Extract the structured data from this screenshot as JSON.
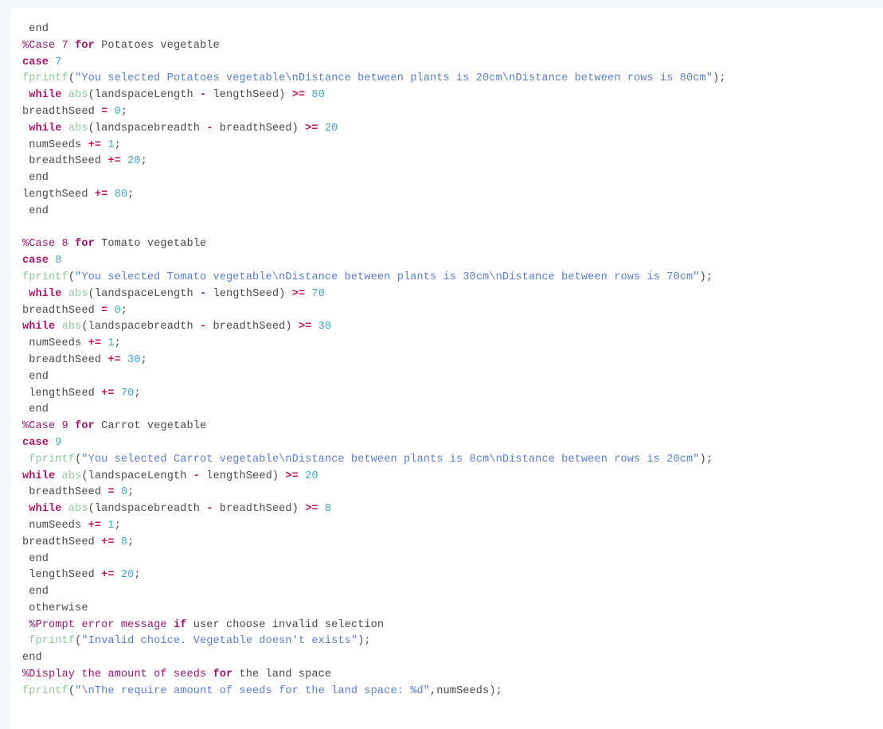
{
  "editor": {
    "language": "matlab",
    "background_color": "#ffffff",
    "page_background_color": "#f4f6f8",
    "default_text_color": "#4a4a4a",
    "token_colors": {
      "keyword": "#b0176a",
      "operator": "#c2185b",
      "number": "#3fa7d6",
      "comment": "#a0156e",
      "function": "#8fc99b",
      "string": "#5b7fd4"
    }
  },
  "code_lines": [
    {
      "id": "line-1",
      "text": " end",
      "tokens": [
        {
          "t": " end",
          "c": "plain"
        }
      ]
    },
    {
      "id": "line-2",
      "text": "%Case 7 for Potatoes vegetable",
      "tokens": [
        {
          "t": "%Case ",
          "c": "comment"
        },
        {
          "t": "7",
          "c": "comment-num"
        },
        {
          "t": " ",
          "c": "comment"
        },
        {
          "t": "for",
          "c": "comment-kw"
        },
        {
          "t": " Potatoes vegetable",
          "c": "plain"
        }
      ]
    },
    {
      "id": "line-3",
      "text": "case 7",
      "tokens": [
        {
          "t": "case",
          "c": "kw"
        },
        {
          "t": " ",
          "c": "plain"
        },
        {
          "t": "7",
          "c": "num"
        }
      ]
    },
    {
      "id": "line-4",
      "text": "fprintf(\"You selected Potatoes vegetable\\nDistance between plants is 20cm\\nDistance between rows is 80cm\");",
      "tokens": [
        {
          "t": "fprintf",
          "c": "fn"
        },
        {
          "t": "(",
          "c": "plain"
        },
        {
          "t": "\"You selected Potatoes vegetable\\nDistance between plants is 20cm\\nDistance between rows is 80cm\"",
          "c": "str"
        },
        {
          "t": ");",
          "c": "plain"
        }
      ]
    },
    {
      "id": "line-5",
      "text": " while abs(landspaceLength - lengthSeed) >= 80",
      "tokens": [
        {
          "t": " ",
          "c": "plain"
        },
        {
          "t": "while",
          "c": "kw"
        },
        {
          "t": " ",
          "c": "plain"
        },
        {
          "t": "abs",
          "c": "fn"
        },
        {
          "t": "(landspaceLength ",
          "c": "plain"
        },
        {
          "t": "-",
          "c": "op"
        },
        {
          "t": " lengthSeed) ",
          "c": "plain"
        },
        {
          "t": ">=",
          "c": "op"
        },
        {
          "t": " ",
          "c": "plain"
        },
        {
          "t": "80",
          "c": "num"
        }
      ]
    },
    {
      "id": "line-6",
      "text": "breadthSeed = 0;",
      "tokens": [
        {
          "t": "breadthSeed ",
          "c": "plain"
        },
        {
          "t": "=",
          "c": "op"
        },
        {
          "t": " ",
          "c": "plain"
        },
        {
          "t": "0",
          "c": "num"
        },
        {
          "t": ";",
          "c": "plain"
        }
      ]
    },
    {
      "id": "line-7",
      "text": " while abs(landspacebreadth - breadthSeed) >= 20",
      "tokens": [
        {
          "t": " ",
          "c": "plain"
        },
        {
          "t": "while",
          "c": "kw"
        },
        {
          "t": " ",
          "c": "plain"
        },
        {
          "t": "abs",
          "c": "fn"
        },
        {
          "t": "(landspacebreadth ",
          "c": "plain"
        },
        {
          "t": "-",
          "c": "op"
        },
        {
          "t": " breadthSeed) ",
          "c": "plain"
        },
        {
          "t": ">=",
          "c": "op"
        },
        {
          "t": " ",
          "c": "plain"
        },
        {
          "t": "20",
          "c": "num"
        }
      ]
    },
    {
      "id": "line-8",
      "text": " numSeeds += 1;",
      "tokens": [
        {
          "t": " numSeeds ",
          "c": "plain"
        },
        {
          "t": "+=",
          "c": "op"
        },
        {
          "t": " ",
          "c": "plain"
        },
        {
          "t": "1",
          "c": "num"
        },
        {
          "t": ";",
          "c": "plain"
        }
      ]
    },
    {
      "id": "line-9",
      "text": " breadthSeed += 20;",
      "tokens": [
        {
          "t": " breadthSeed ",
          "c": "plain"
        },
        {
          "t": "+=",
          "c": "op"
        },
        {
          "t": " ",
          "c": "plain"
        },
        {
          "t": "20",
          "c": "num"
        },
        {
          "t": ";",
          "c": "plain"
        }
      ]
    },
    {
      "id": "line-10",
      "text": " end",
      "tokens": [
        {
          "t": " end",
          "c": "plain"
        }
      ]
    },
    {
      "id": "line-11",
      "text": "lengthSeed += 80;",
      "tokens": [
        {
          "t": "lengthSeed ",
          "c": "plain"
        },
        {
          "t": "+=",
          "c": "op"
        },
        {
          "t": " ",
          "c": "plain"
        },
        {
          "t": "80",
          "c": "num"
        },
        {
          "t": ";",
          "c": "plain"
        }
      ]
    },
    {
      "id": "line-12",
      "text": " end",
      "tokens": [
        {
          "t": " end",
          "c": "plain"
        }
      ]
    },
    {
      "id": "line-13",
      "text": "",
      "tokens": []
    },
    {
      "id": "line-14",
      "text": "%Case 8 for Tomato vegetable",
      "tokens": [
        {
          "t": "%Case ",
          "c": "comment"
        },
        {
          "t": "8",
          "c": "comment-num"
        },
        {
          "t": " ",
          "c": "comment"
        },
        {
          "t": "for",
          "c": "comment-kw"
        },
        {
          "t": " Tomato vegetable",
          "c": "plain"
        }
      ]
    },
    {
      "id": "line-15",
      "text": "case 8",
      "tokens": [
        {
          "t": "case",
          "c": "kw"
        },
        {
          "t": " ",
          "c": "plain"
        },
        {
          "t": "8",
          "c": "num"
        }
      ]
    },
    {
      "id": "line-16",
      "text": "fprintf(\"You selected Tomato vegetable\\nDistance between plants is 30cm\\nDistance between rows is 70cm\");",
      "tokens": [
        {
          "t": "fprintf",
          "c": "fn"
        },
        {
          "t": "(",
          "c": "plain"
        },
        {
          "t": "\"You selected Tomato vegetable\\nDistance between plants is 30cm\\nDistance between rows is 70cm\"",
          "c": "str"
        },
        {
          "t": ");",
          "c": "plain"
        }
      ]
    },
    {
      "id": "line-17",
      "text": " while abs(landspaceLength - lengthSeed) >= 70",
      "tokens": [
        {
          "t": " ",
          "c": "plain"
        },
        {
          "t": "while",
          "c": "kw"
        },
        {
          "t": " ",
          "c": "plain"
        },
        {
          "t": "abs",
          "c": "fn"
        },
        {
          "t": "(landspaceLength ",
          "c": "plain"
        },
        {
          "t": "-",
          "c": "op"
        },
        {
          "t": " lengthSeed) ",
          "c": "plain"
        },
        {
          "t": ">=",
          "c": "op"
        },
        {
          "t": " ",
          "c": "plain"
        },
        {
          "t": "70",
          "c": "num"
        }
      ]
    },
    {
      "id": "line-18",
      "text": "breadthSeed = 0;",
      "tokens": [
        {
          "t": "breadthSeed ",
          "c": "plain"
        },
        {
          "t": "=",
          "c": "op"
        },
        {
          "t": " ",
          "c": "plain"
        },
        {
          "t": "0",
          "c": "num"
        },
        {
          "t": ";",
          "c": "plain"
        }
      ]
    },
    {
      "id": "line-19",
      "text": "while abs(landspacebreadth - breadthSeed) >= 30",
      "tokens": [
        {
          "t": "while",
          "c": "kw"
        },
        {
          "t": " ",
          "c": "plain"
        },
        {
          "t": "abs",
          "c": "fn"
        },
        {
          "t": "(landspacebreadth ",
          "c": "plain"
        },
        {
          "t": "-",
          "c": "op"
        },
        {
          "t": " breadthSeed) ",
          "c": "plain"
        },
        {
          "t": ">=",
          "c": "op"
        },
        {
          "t": " ",
          "c": "plain"
        },
        {
          "t": "30",
          "c": "num"
        }
      ]
    },
    {
      "id": "line-20",
      "text": " numSeeds += 1;",
      "tokens": [
        {
          "t": " numSeeds ",
          "c": "plain"
        },
        {
          "t": "+=",
          "c": "op"
        },
        {
          "t": " ",
          "c": "plain"
        },
        {
          "t": "1",
          "c": "num"
        },
        {
          "t": ";",
          "c": "plain"
        }
      ]
    },
    {
      "id": "line-21",
      "text": " breadthSeed += 30;",
      "tokens": [
        {
          "t": " breadthSeed ",
          "c": "plain"
        },
        {
          "t": "+=",
          "c": "op"
        },
        {
          "t": " ",
          "c": "plain"
        },
        {
          "t": "30",
          "c": "num"
        },
        {
          "t": ";",
          "c": "plain"
        }
      ]
    },
    {
      "id": "line-22",
      "text": " end",
      "tokens": [
        {
          "t": " end",
          "c": "plain"
        }
      ]
    },
    {
      "id": "line-23",
      "text": " lengthSeed += 70;",
      "tokens": [
        {
          "t": " lengthSeed ",
          "c": "plain"
        },
        {
          "t": "+=",
          "c": "op"
        },
        {
          "t": " ",
          "c": "plain"
        },
        {
          "t": "70",
          "c": "num"
        },
        {
          "t": ";",
          "c": "plain"
        }
      ]
    },
    {
      "id": "line-24",
      "text": " end",
      "tokens": [
        {
          "t": " end",
          "c": "plain"
        }
      ]
    },
    {
      "id": "line-25",
      "text": "%Case 9 for Carrot vegetable",
      "tokens": [
        {
          "t": "%Case ",
          "c": "comment"
        },
        {
          "t": "9",
          "c": "comment-num"
        },
        {
          "t": " ",
          "c": "comment"
        },
        {
          "t": "for",
          "c": "comment-kw"
        },
        {
          "t": " Carrot vegetable",
          "c": "plain"
        }
      ]
    },
    {
      "id": "line-26",
      "text": "case 9",
      "tokens": [
        {
          "t": "case",
          "c": "kw"
        },
        {
          "t": " ",
          "c": "plain"
        },
        {
          "t": "9",
          "c": "num"
        }
      ]
    },
    {
      "id": "line-27",
      "text": " fprintf(\"You selected Carrot vegetable\\nDistance between plants is 8cm\\nDistance between rows is 20cm\");",
      "tokens": [
        {
          "t": " ",
          "c": "plain"
        },
        {
          "t": "fprintf",
          "c": "fn"
        },
        {
          "t": "(",
          "c": "plain"
        },
        {
          "t": "\"You selected Carrot vegetable\\nDistance between plants is 8cm\\nDistance between rows is 20cm\"",
          "c": "str"
        },
        {
          "t": ");",
          "c": "plain"
        }
      ]
    },
    {
      "id": "line-28",
      "text": "while abs(landspaceLength - lengthSeed) >= 20",
      "tokens": [
        {
          "t": "while",
          "c": "kw"
        },
        {
          "t": " ",
          "c": "plain"
        },
        {
          "t": "abs",
          "c": "fn"
        },
        {
          "t": "(landspaceLength ",
          "c": "plain"
        },
        {
          "t": "-",
          "c": "op"
        },
        {
          "t": " lengthSeed) ",
          "c": "plain"
        },
        {
          "t": ">=",
          "c": "op"
        },
        {
          "t": " ",
          "c": "plain"
        },
        {
          "t": "20",
          "c": "num"
        }
      ]
    },
    {
      "id": "line-29",
      "text": " breadthSeed = 0;",
      "tokens": [
        {
          "t": " breadthSeed ",
          "c": "plain"
        },
        {
          "t": "=",
          "c": "op"
        },
        {
          "t": " ",
          "c": "plain"
        },
        {
          "t": "0",
          "c": "num"
        },
        {
          "t": ";",
          "c": "plain"
        }
      ]
    },
    {
      "id": "line-30",
      "text": " while abs(landspacebreadth - breadthSeed) >= 8",
      "tokens": [
        {
          "t": " ",
          "c": "plain"
        },
        {
          "t": "while",
          "c": "kw"
        },
        {
          "t": " ",
          "c": "plain"
        },
        {
          "t": "abs",
          "c": "fn"
        },
        {
          "t": "(landspacebreadth ",
          "c": "plain"
        },
        {
          "t": "-",
          "c": "op"
        },
        {
          "t": " breadthSeed) ",
          "c": "plain"
        },
        {
          "t": ">=",
          "c": "op"
        },
        {
          "t": " ",
          "c": "plain"
        },
        {
          "t": "8",
          "c": "num"
        }
      ]
    },
    {
      "id": "line-31",
      "text": " numSeeds += 1;",
      "tokens": [
        {
          "t": " numSeeds ",
          "c": "plain"
        },
        {
          "t": "+=",
          "c": "op"
        },
        {
          "t": " ",
          "c": "plain"
        },
        {
          "t": "1",
          "c": "num"
        },
        {
          "t": ";",
          "c": "plain"
        }
      ]
    },
    {
      "id": "line-32",
      "text": "breadthSeed += 8;",
      "tokens": [
        {
          "t": "breadthSeed ",
          "c": "plain"
        },
        {
          "t": "+=",
          "c": "op"
        },
        {
          "t": " ",
          "c": "plain"
        },
        {
          "t": "8",
          "c": "num"
        },
        {
          "t": ";",
          "c": "plain"
        }
      ]
    },
    {
      "id": "line-33",
      "text": " end",
      "tokens": [
        {
          "t": " end",
          "c": "plain"
        }
      ]
    },
    {
      "id": "line-34",
      "text": " lengthSeed += 20;",
      "tokens": [
        {
          "t": " lengthSeed ",
          "c": "plain"
        },
        {
          "t": "+=",
          "c": "op"
        },
        {
          "t": " ",
          "c": "plain"
        },
        {
          "t": "20",
          "c": "num"
        },
        {
          "t": ";",
          "c": "plain"
        }
      ]
    },
    {
      "id": "line-35",
      "text": " end",
      "tokens": [
        {
          "t": " end",
          "c": "plain"
        }
      ]
    },
    {
      "id": "line-36",
      "text": " otherwise",
      "tokens": [
        {
          "t": " otherwise",
          "c": "plain"
        }
      ]
    },
    {
      "id": "line-37",
      "text": " %Prompt error message if user choose invalid selection",
      "tokens": [
        {
          "t": " ",
          "c": "plain"
        },
        {
          "t": "%Prompt error message ",
          "c": "comment"
        },
        {
          "t": "if",
          "c": "comment-kw"
        },
        {
          "t": " user choose invalid selection",
          "c": "plain"
        }
      ]
    },
    {
      "id": "line-38",
      "text": " fprintf(\"Invalid choice. Vegetable doesn't exists\");",
      "tokens": [
        {
          "t": " ",
          "c": "plain"
        },
        {
          "t": "fprintf",
          "c": "fn"
        },
        {
          "t": "(",
          "c": "plain"
        },
        {
          "t": "\"Invalid choice. Vegetable doesn't exists\"",
          "c": "str"
        },
        {
          "t": ");",
          "c": "plain"
        }
      ]
    },
    {
      "id": "line-39",
      "text": "end",
      "tokens": [
        {
          "t": "end",
          "c": "plain"
        }
      ]
    },
    {
      "id": "line-40",
      "text": "%Display the amount of seeds for the land space",
      "tokens": [
        {
          "t": "%Display the amount of seeds ",
          "c": "comment"
        },
        {
          "t": "for",
          "c": "comment-kw"
        },
        {
          "t": " the land space",
          "c": "plain"
        }
      ]
    },
    {
      "id": "line-41",
      "text": "fprintf(\"\\nThe require amount of seeds for the land space: %d\",numSeeds);",
      "tokens": [
        {
          "t": "fprintf",
          "c": "fn"
        },
        {
          "t": "(",
          "c": "plain"
        },
        {
          "t": "\"\\nThe require amount of seeds for the land space: %d\"",
          "c": "str"
        },
        {
          "t": ",numSeeds);",
          "c": "plain"
        }
      ]
    }
  ]
}
